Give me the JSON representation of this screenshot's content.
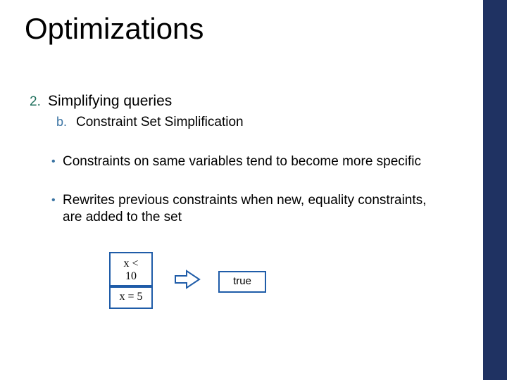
{
  "title": "Optimizations",
  "list": {
    "level1_marker": "2.",
    "level1_text": "Simplifying queries",
    "level2_marker": "b.",
    "level2_text": "Constraint Set Simplification"
  },
  "bullets": {
    "b1": "Constraints on same variables tend to become more specific",
    "b2": "Rewrites previous constraints when new, equality constraints, are added to the set"
  },
  "boxes": {
    "box1": "x < 10",
    "box2": "x = 5",
    "box3": "true"
  },
  "colors": {
    "sidebar": "#1f3262",
    "accent_green": "#1f6f5c",
    "accent_blue": "#3b74a3",
    "border_blue": "#1f5ca8"
  }
}
